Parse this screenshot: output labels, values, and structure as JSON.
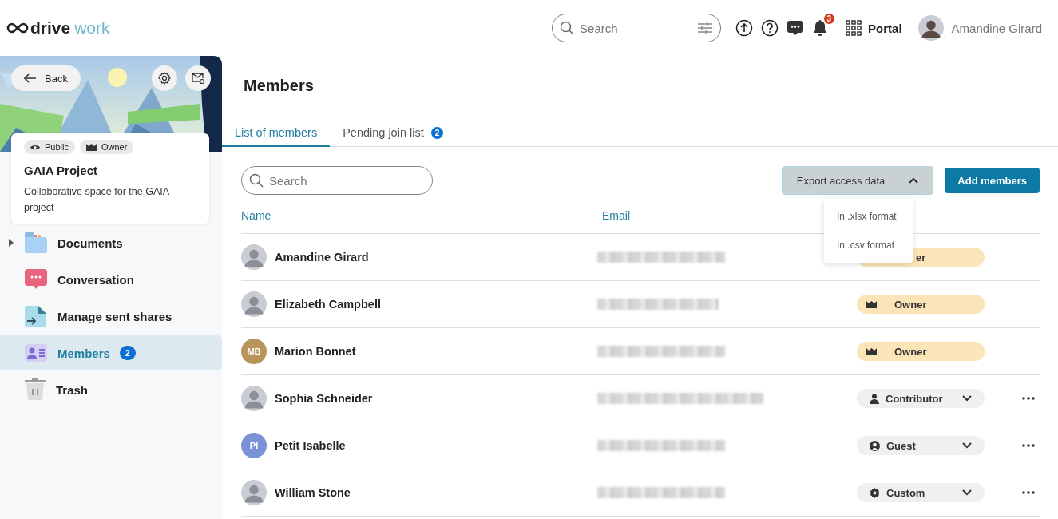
{
  "header": {
    "logo": {
      "main": "drive",
      "accent": "work"
    },
    "search": {
      "placeholder": "Search"
    },
    "notifications": "3",
    "portal": "Portal",
    "user": "Amandine Girard"
  },
  "sidebar": {
    "back": "Back",
    "tags": [
      {
        "kind": "visibility",
        "label": "Public"
      },
      {
        "kind": "role",
        "label": "Owner"
      }
    ],
    "title": "GAIA Project",
    "description": "Collaborative space for the GAIA project",
    "items": [
      {
        "kind": "documents",
        "label": "Documents",
        "expandable": true,
        "selected": false
      },
      {
        "kind": "conversation",
        "label": "Conversation",
        "expandable": false,
        "selected": false
      },
      {
        "kind": "shares",
        "label": "Manage sent shares",
        "expandable": false,
        "selected": false
      },
      {
        "kind": "members",
        "label": "Members",
        "expandable": false,
        "selected": true,
        "badge": "2"
      },
      {
        "kind": "trash",
        "label": "Trash",
        "expandable": false,
        "selected": false
      }
    ]
  },
  "main": {
    "title": "Members",
    "tabs": [
      {
        "label": "List of members",
        "selected": true
      },
      {
        "label": "Pending join list",
        "selected": false,
        "badge": "2"
      }
    ],
    "search": {
      "placeholder": "Search"
    },
    "export": {
      "label": "Export access data",
      "expanded": true,
      "options": [
        "In .xlsx format",
        "In .csv format"
      ]
    },
    "add_button": "Add members",
    "columns": [
      "Name",
      "Email"
    ],
    "rows": [
      {
        "name": "Amandine Girard",
        "role": {
          "kind": "owner",
          "label": "er",
          "editable": false
        },
        "actions": false
      },
      {
        "name": "Elizabeth Campbell",
        "role": {
          "kind": "owner",
          "label": "Owner",
          "editable": false
        },
        "actions": false
      },
      {
        "name": "Marion Bonnet",
        "avatar": {
          "kind": "initials",
          "text": "MB",
          "color": "#b8955a"
        },
        "role": {
          "kind": "owner",
          "label": "Owner",
          "editable": false
        },
        "actions": false
      },
      {
        "name": "Sophia Schneider",
        "role": {
          "kind": "contributor",
          "label": "Contributor",
          "editable": true
        },
        "actions": true
      },
      {
        "name": "Petit Isabelle",
        "avatar": {
          "kind": "initials",
          "text": "PI",
          "color": "#7b93d6"
        },
        "role": {
          "kind": "guest",
          "label": "Guest",
          "editable": true
        },
        "actions": true
      },
      {
        "name": "William Stone",
        "role": {
          "kind": "custom",
          "label": "Custom",
          "editable": true
        },
        "actions": true
      }
    ]
  }
}
